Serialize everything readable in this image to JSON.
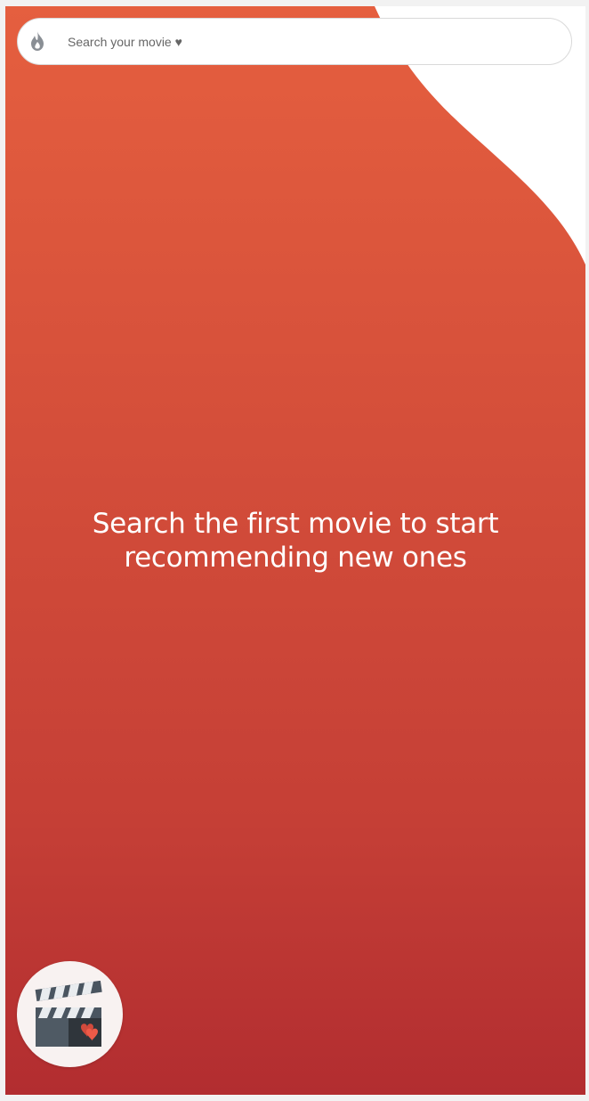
{
  "search": {
    "placeholder": "Search your movie ♥",
    "icon": "flame-icon"
  },
  "hero": {
    "line1": "Search the first movie to start",
    "line2": "recommending new ones"
  },
  "fab": {
    "icon": "clapperboard-heart-icon"
  },
  "colors": {
    "gradient_top": "#e55f3f",
    "gradient_bottom": "#b22d30",
    "search_bg": "#ffffff",
    "fab_bg": "#f8f2f1",
    "heart": "#e24a3c"
  }
}
